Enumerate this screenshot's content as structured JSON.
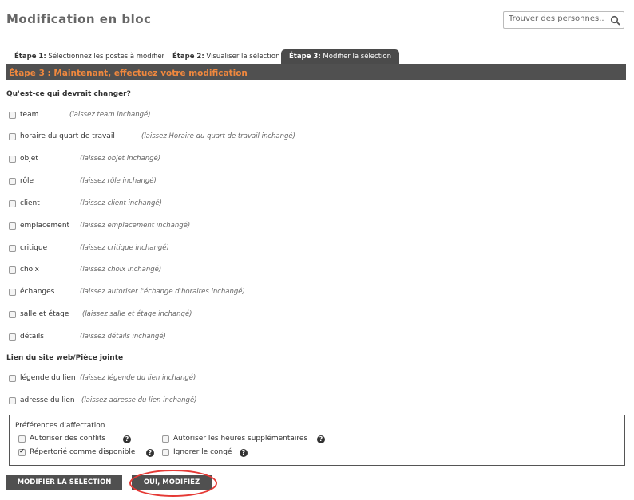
{
  "header": {
    "title": "Modification en bloc",
    "search_placeholder": "Trouver des personnes.."
  },
  "tabs": [
    {
      "prefix": "Étape 1:",
      "label": " Sélectionnez les postes à modifier",
      "active": false
    },
    {
      "prefix": "Étape 2:",
      "label": " Visualiser la sélection",
      "active": false
    },
    {
      "prefix": "Étape 3:",
      "label": " Modifier la sélection",
      "active": true
    }
  ],
  "step_bar": {
    "text": "Étape 3 : Maintenant, effectuez votre modification"
  },
  "what_change": {
    "title": "Qu'est-ce qui devrait changer?",
    "fields": [
      {
        "label": "team",
        "hint": "(laissez team inchangé)"
      },
      {
        "label": "horaire du quart de travail",
        "hint": "(laissez Horaire du quart de travail inchangé)"
      },
      {
        "label": "objet",
        "hint": "(laissez objet inchangé)"
      },
      {
        "label": "rôle",
        "hint": "(laissez rôle inchangé)"
      },
      {
        "label": "client",
        "hint": "(laissez client inchangé)"
      },
      {
        "label": "emplacement",
        "hint": "(laissez emplacement inchangé)"
      },
      {
        "label": "critique",
        "hint": "(laissez critique inchangé)"
      },
      {
        "label": "choix",
        "hint": "(laissez choix inchangé)"
      },
      {
        "label": "échanges",
        "hint": "(laissez autoriser l'échange d'horaires inchangé)"
      },
      {
        "label": "salle et étage",
        "hint": "(laissez salle et étage inchangé)"
      },
      {
        "label": "détails",
        "hint": "(laissez détails inchangé)"
      }
    ]
  },
  "web_link": {
    "title": "Lien du site web/Pièce jointe",
    "fields": [
      {
        "label": "légende du lien",
        "hint": "(laissez légende du lien inchangé)"
      },
      {
        "label": "adresse du lien",
        "hint": "(laissez adresse du lien inchangé)"
      }
    ]
  },
  "preferences": {
    "title": "Préférences d'affectation",
    "items": [
      {
        "label": "Autoriser des conflits",
        "checked": false
      },
      {
        "label": "Autoriser les heures supplémentaires",
        "checked": false
      },
      {
        "label": "Répertorié comme disponible",
        "checked": true
      },
      {
        "label": "Ignorer le congé",
        "checked": false
      }
    ],
    "help_glyph": "?"
  },
  "buttons": {
    "modify_selection": "MODIFIER LA SÉLECTION",
    "confirm": "OUI, MODIFIEZ"
  }
}
